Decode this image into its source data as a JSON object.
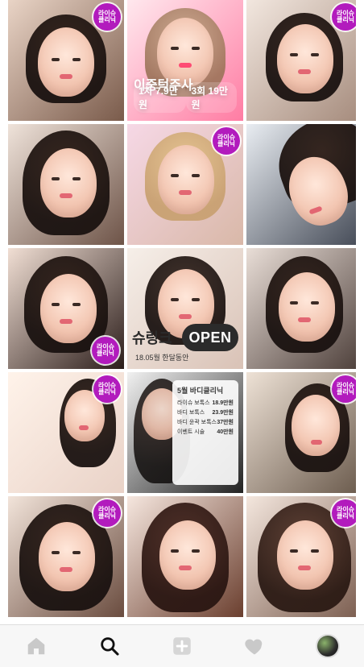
{
  "badges": {
    "clinic_label": "라이슈\n클리닉"
  },
  "promo": {
    "tile2_title": "이중턱주사",
    "tile2_price_left": "1차 7.9만원",
    "tile2_price_right": "3회 19만원",
    "tile8_open_left": "슈링크",
    "tile8_open_pill": "OPEN",
    "tile8_sub": "18.05월 한달동안",
    "tile11_list_title": "5월 바디클리닉",
    "tile11_rows": [
      [
        "라이슈 보톡스",
        "18.9만원"
      ],
      [
        "바디 보톡스",
        "23.9만원"
      ],
      [
        "바디 윤곽 보톡스",
        "37만원"
      ],
      [
        "이벤트 시술",
        "40만원"
      ]
    ]
  },
  "tiles": [
    {
      "id": 1,
      "theme": "portrait",
      "bg1": "#e9d4c6",
      "bg2": "#7a5b4b",
      "badge": true
    },
    {
      "id": 2,
      "theme": "promo_pink",
      "bg1": "#ffe8ee",
      "bg2": "#ff7ca3",
      "badge": false
    },
    {
      "id": 3,
      "theme": "portrait",
      "bg1": "#f2e7df",
      "bg2": "#a58b7c",
      "badge": true
    },
    {
      "id": 4,
      "theme": "portrait",
      "bg1": "#efe3da",
      "bg2": "#6e5448",
      "badge": false
    },
    {
      "id": 5,
      "theme": "portrait_store",
      "bg1": "#f6d8e6",
      "bg2": "#d9b8a8",
      "badge": true
    },
    {
      "id": 6,
      "theme": "portrait_side",
      "bg1": "#e9edf2",
      "bg2": "#444a56",
      "badge": false
    },
    {
      "id": 7,
      "theme": "portrait_uniform",
      "bg1": "#f1dfd4",
      "bg2": "#2b1d1a",
      "badge": true
    },
    {
      "id": 8,
      "theme": "promo_open",
      "bg1": "#f6efe9",
      "bg2": "#d9c2b6",
      "badge": false
    },
    {
      "id": 9,
      "theme": "portrait_car",
      "bg1": "#e9ded7",
      "bg2": "#4c3e39",
      "badge": false
    },
    {
      "id": 10,
      "theme": "selfie_mirror",
      "bg1": "#fff3ea",
      "bg2": "#e9d2c7",
      "badge": true
    },
    {
      "id": 11,
      "theme": "promo_list",
      "bg1": "#f1f1f1",
      "bg2": "#222222",
      "badge": false
    },
    {
      "id": 12,
      "theme": "portrait_office",
      "bg1": "#eee2d6",
      "bg2": "#6a5a4c",
      "badge": true
    },
    {
      "id": 13,
      "theme": "portrait",
      "bg1": "#f2e4da",
      "bg2": "#6a4c3f",
      "badge": true
    },
    {
      "id": 14,
      "theme": "portrait",
      "bg1": "#f6e7df",
      "bg2": "#6b3f2f",
      "badge": false
    },
    {
      "id": 15,
      "theme": "portrait",
      "bg1": "#f4e7de",
      "bg2": "#7a5c4e",
      "badge": true
    }
  ],
  "nav": {
    "items": [
      {
        "name": "home",
        "icon": "home-icon"
      },
      {
        "name": "search",
        "icon": "search-icon"
      },
      {
        "name": "add",
        "icon": "add-post-icon"
      },
      {
        "name": "activity",
        "icon": "heart-icon"
      },
      {
        "name": "profile",
        "icon": "profile-avatar-icon"
      }
    ]
  }
}
